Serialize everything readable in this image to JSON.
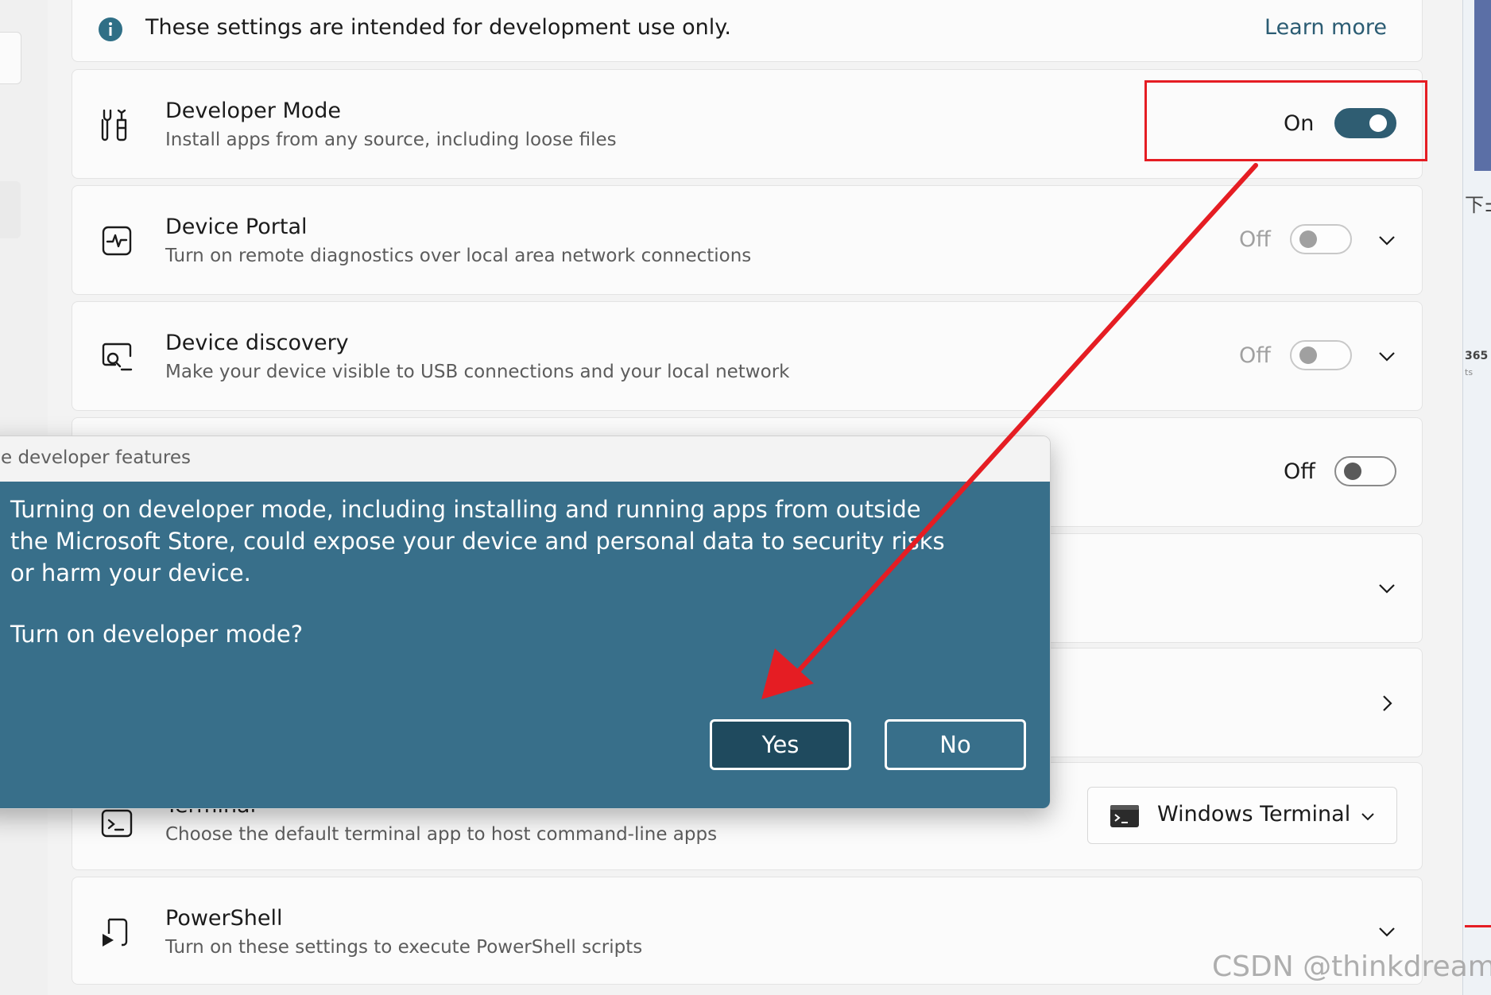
{
  "info_bar": {
    "text": "These settings are intended for development use only.",
    "link": "Learn more"
  },
  "developer_mode": {
    "title": "Developer Mode",
    "description": "Install apps from any source, including loose files",
    "state": "On"
  },
  "device_portal": {
    "title": "Device Portal",
    "description": "Turn on remote diagnostics over local area network connections",
    "state": "Off"
  },
  "device_discovery": {
    "title": "Device discovery",
    "description": "Make your device visible to USB connections and your local network",
    "state": "Off"
  },
  "hidden_row": {
    "state": "Off"
  },
  "terminal": {
    "title": "Terminal",
    "description": "Choose the default terminal app to host command-line apps",
    "selected": "Windows Terminal"
  },
  "powershell": {
    "title": "PowerShell",
    "description": "Turn on these settings to execute PowerShell scripts"
  },
  "dialog": {
    "title": "e developer features",
    "message": "Turning on developer mode, including installing and running apps from outside the Microsoft Store, could expose your device and personal data to security risks or harm your device.",
    "question": "Turn on developer mode?",
    "yes": "Yes",
    "no": "No"
  },
  "right_edge": {
    "text_top": "下±",
    "number": "365",
    "small": "ts"
  },
  "watermark": "CSDN @thinkdreamyy",
  "colors": {
    "accent": "#2f5d72",
    "dialog_bg": "#386f8a",
    "annotation": "#e51d23"
  }
}
